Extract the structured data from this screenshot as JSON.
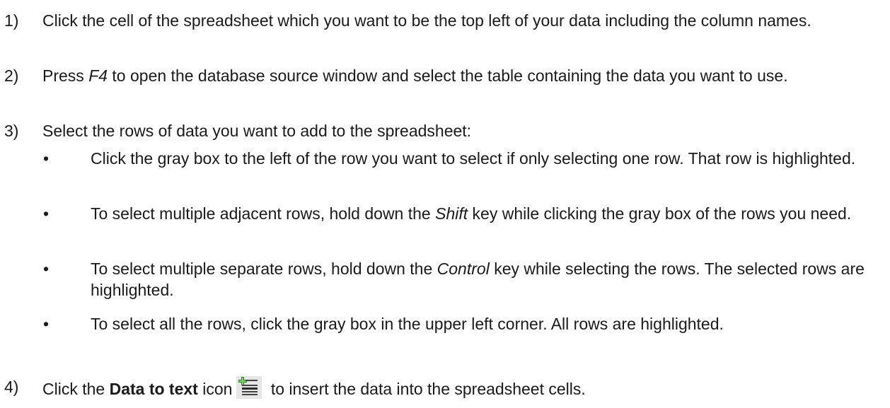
{
  "steps": [
    {
      "num": "1)",
      "text": "Click the cell of the spreadsheet which you want to be the top left of your data including the column names."
    },
    {
      "num": "2)",
      "pre": "Press ",
      "key": "F4",
      "post": " to open the database source window and select the table containing the data you want to use."
    },
    {
      "num": "3)",
      "text": "Select the rows of data you want to add to the spreadsheet:"
    },
    {
      "num": "4)",
      "pre": "Click the ",
      "bold": "Data to text",
      "mid": " icon",
      "post": " to insert the data into the spreadsheet cells."
    }
  ],
  "bullets": [
    {
      "dot": "•",
      "text": "Click the gray box to the left of the row you want to select if only selecting one row. That row is highlighted."
    },
    {
      "dot": "•",
      "pre": "To select multiple adjacent rows, hold down the ",
      "key": "Shift",
      "post": " key while clicking the gray box of the rows you need."
    },
    {
      "dot": "•",
      "pre": "To select multiple separate rows, hold down the ",
      "key": "Control",
      "post": " key while selecting the rows. The selected rows are highlighted."
    },
    {
      "dot": "•",
      "text": "To select all the rows, click the gray box in the upper left corner. All rows are highlighted."
    }
  ],
  "icons": {
    "data_to_text": "data-to-text-icon"
  }
}
